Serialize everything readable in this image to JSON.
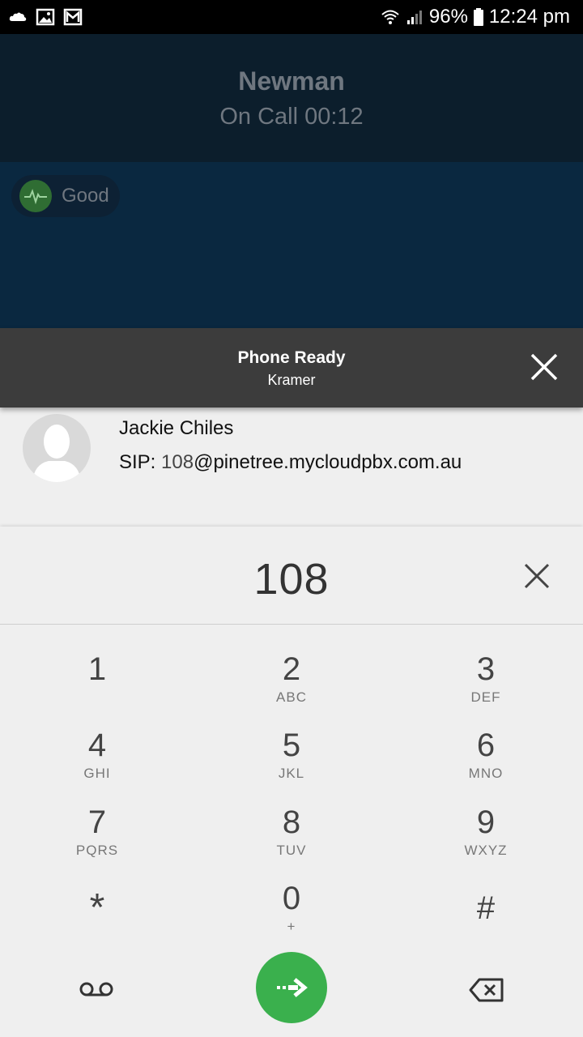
{
  "status_bar": {
    "icons_left": [
      "cloud-icon",
      "image-icon",
      "gmail-icon"
    ],
    "battery": "96%",
    "time": "12:24 pm"
  },
  "call": {
    "name": "Newman",
    "status": "On Call  00:12",
    "quality": "Good"
  },
  "banner": {
    "title": "Phone Ready",
    "subtitle": "Kramer"
  },
  "contact": {
    "name": "Jackie Chiles",
    "sip_label": "SIP: ",
    "sip_number": "108",
    "sip_domain": "@pinetree.mycloudpbx.com.au"
  },
  "dialpad": {
    "value": "108",
    "keys": [
      {
        "digit": "1",
        "letters": ""
      },
      {
        "digit": "2",
        "letters": "ABC"
      },
      {
        "digit": "3",
        "letters": "DEF"
      },
      {
        "digit": "4",
        "letters": "GHI"
      },
      {
        "digit": "5",
        "letters": "JKL"
      },
      {
        "digit": "6",
        "letters": "MNO"
      },
      {
        "digit": "7",
        "letters": "PQRS"
      },
      {
        "digit": "8",
        "letters": "TUV"
      },
      {
        "digit": "9",
        "letters": "WXYZ"
      },
      {
        "digit": "*",
        "letters": ""
      },
      {
        "digit": "0",
        "letters": "+"
      },
      {
        "digit": "#",
        "letters": ""
      }
    ]
  },
  "colors": {
    "call_button": "#3ab04d",
    "banner_bg": "#3c3c3c",
    "call_header_bg": "#0c1e2c"
  }
}
